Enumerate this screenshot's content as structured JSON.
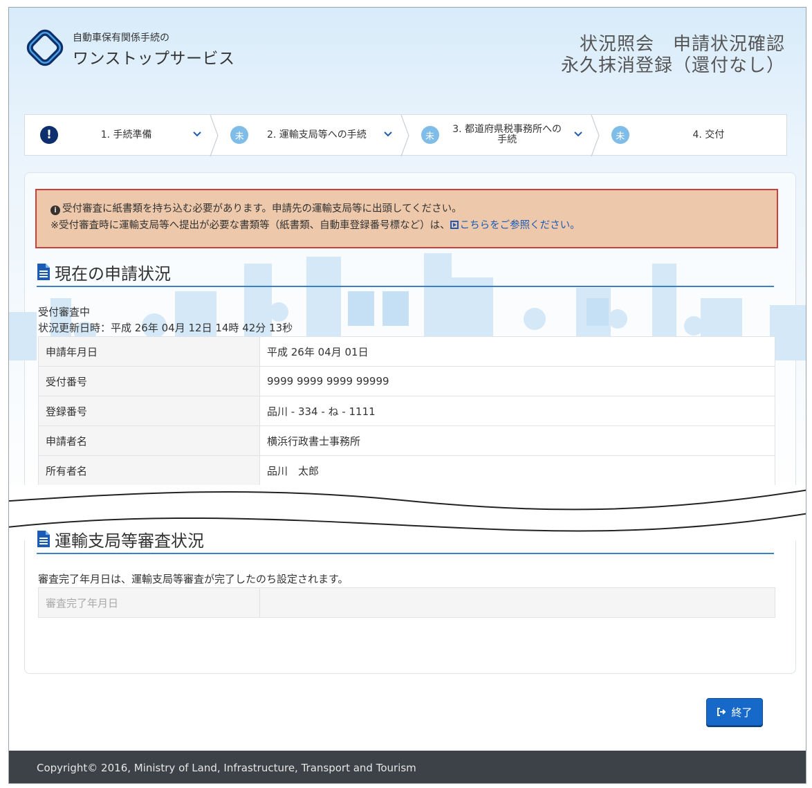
{
  "header": {
    "brand_small": "自動車保有関係手続の",
    "brand_large": "ワンストップサービス",
    "title_line1": "状況照会　申請状況確認",
    "title_line2": "永久抹消登録（還付なし）"
  },
  "stepper": {
    "steps": [
      {
        "badge": "!",
        "label": "1. 手続準備",
        "state": "alert",
        "icon": "exclamation-icon"
      },
      {
        "badge": "未",
        "label": "2. 運輸支局等への手続",
        "state": "pending"
      },
      {
        "badge": "未",
        "label": "3. 都道府県税事務所への手続",
        "state": "pending"
      },
      {
        "badge": "未",
        "label": "4. 交付",
        "state": "pending"
      }
    ]
  },
  "notice": {
    "line1": "受付審査に紙書類を持ち込む必要があります。申請先の運輸支局等に出頭してください。",
    "line2_prefix": "※受付審査時に運輸支局等へ提出が必要な書類等（紙書類、自動車登録番号標など）は、",
    "line2_link": "こちらをご参照ください。",
    "colors": {
      "background": "#eec8aa",
      "border": "#c9403c",
      "link": "#1c5bb5"
    }
  },
  "current_status": {
    "heading": "現在の申請状況",
    "status": "受付審査中",
    "updated": "状況更新日時：平成 26年 04月 12日 14時 42分 13秒",
    "rows": [
      {
        "key": "申請年月日",
        "value": "平成 26年 04月 01日"
      },
      {
        "key": "受付番号",
        "value": "9999 9999 9999 99999"
      },
      {
        "key": "登録番号",
        "value": "品川 - 334 - ね - 1111"
      },
      {
        "key": "申請者名",
        "value": "横浜行政書士事務所"
      },
      {
        "key": "所有者名",
        "value": "品川　太郎"
      }
    ]
  },
  "review": {
    "heading": "運輸支局等審査状況",
    "note": "審査完了年月日は、運輸支局等審査が完了したのち設定されます。",
    "rows": [
      {
        "key": "審査完了年月日",
        "value": ""
      }
    ]
  },
  "actions": {
    "end_label": "終了",
    "accent": "#1769c9"
  },
  "footer": {
    "copyright": "Copyright© 2016, Ministry of Land, Infrastructure, Transport and Tourism"
  }
}
